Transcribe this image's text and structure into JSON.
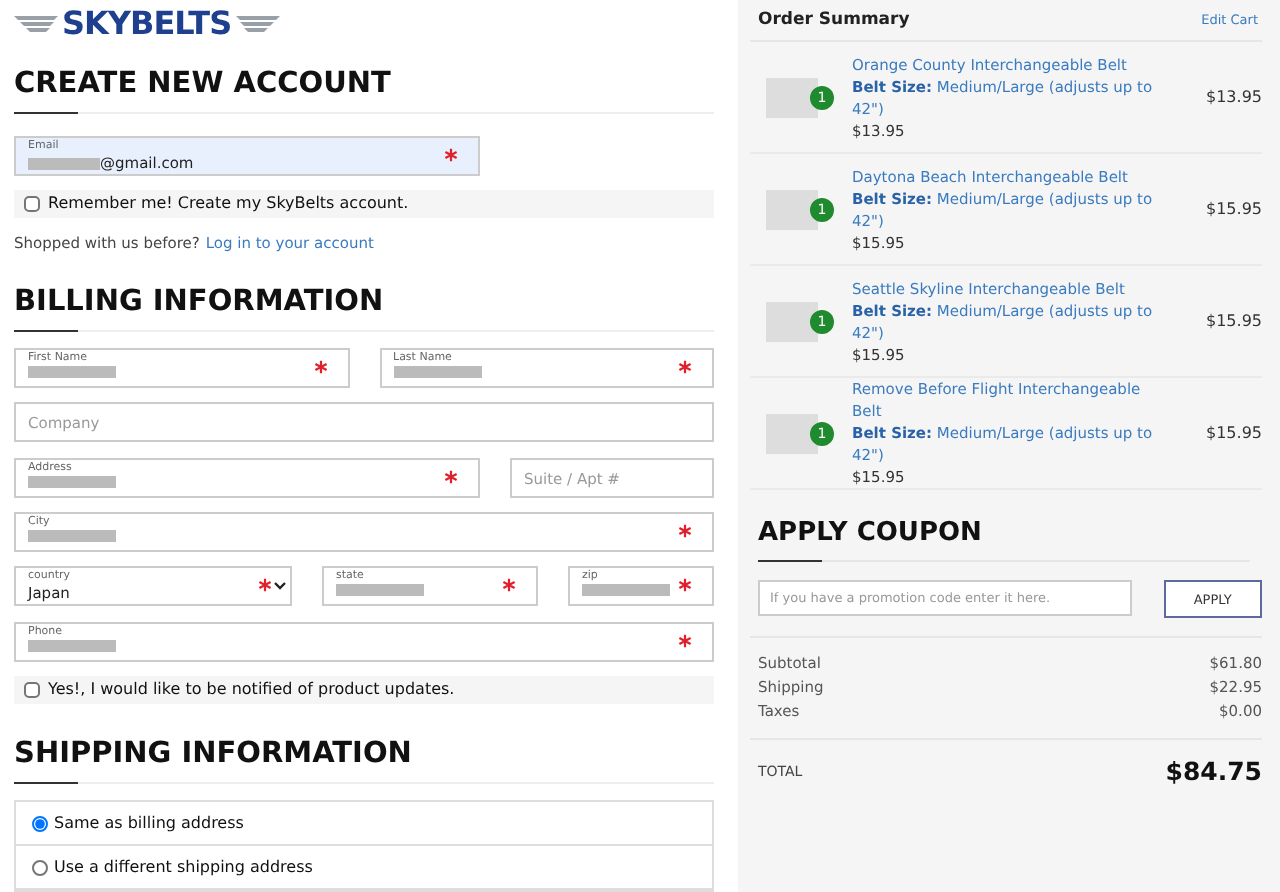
{
  "logo": {
    "text": "SKYBELTS"
  },
  "account": {
    "heading": "CREATE NEW ACCOUNT",
    "email": {
      "label": "Email",
      "value": "@gmail.com",
      "redacted": true,
      "required": true,
      "focused": true
    },
    "remember": {
      "label": "Remember me! Create my SkyBelts account.",
      "checked": false
    },
    "login_prompt": {
      "text": "Shopped with us before?",
      "link": "Log in to your account"
    }
  },
  "billing": {
    "heading": "BILLING INFORMATION",
    "fields": [
      {
        "kind": "text",
        "label": "First Name",
        "redacted": true,
        "required": true
      },
      {
        "kind": "text",
        "label": "Last Name",
        "redacted": true,
        "required": true
      },
      {
        "kind": "empty",
        "placeholder": "Company",
        "required": false
      },
      {
        "kind": "text",
        "label": "Address",
        "redacted": true,
        "required": true
      },
      {
        "kind": "empty",
        "placeholder": "Suite / Apt #",
        "required": false
      },
      {
        "kind": "text",
        "label": "City",
        "redacted": true,
        "required": true
      },
      {
        "kind": "select",
        "label": "country",
        "value": "Japan",
        "required": true
      },
      {
        "kind": "text",
        "label": "state",
        "redacted": true,
        "required": true
      },
      {
        "kind": "text",
        "label": "zip",
        "redacted": true,
        "required": true
      },
      {
        "kind": "text",
        "label": "Phone",
        "redacted": true,
        "required": true
      }
    ],
    "notify": {
      "label": "Yes!, I would like to be notified of product updates.",
      "checked": false
    }
  },
  "shipping": {
    "heading": "SHIPPING INFORMATION",
    "options": [
      {
        "label": "Same as billing address",
        "selected": true
      },
      {
        "label": "Use a different shipping address",
        "selected": false
      }
    ]
  },
  "summary": {
    "title": "Order Summary",
    "edit_link": "Edit Cart",
    "items": [
      {
        "name": "Orange County Interchangeable Belt",
        "option_label": "Belt Size:",
        "option_value": "Medium/Large (adjusts up to 42\")",
        "unit_price": "$13.95",
        "quantity": "1",
        "price": "$13.95"
      },
      {
        "name": "Daytona Beach Interchangeable Belt",
        "option_label": "Belt Size:",
        "option_value": "Medium/Large (adjusts up to 42\")",
        "unit_price": "$15.95",
        "quantity": "1",
        "price": "$15.95"
      },
      {
        "name": "Seattle Skyline Interchangeable Belt",
        "option_label": "Belt Size:",
        "option_value": "Medium/Large (adjusts up to 42\")",
        "unit_price": "$15.95",
        "quantity": "1",
        "price": "$15.95"
      },
      {
        "name": "Remove Before Flight Interchangeable Belt",
        "option_label": "Belt Size:",
        "option_value": "Medium/Large (adjusts up to 42\")",
        "unit_price": "$15.95",
        "quantity": "1",
        "price": "$15.95"
      }
    ],
    "coupon": {
      "heading": "APPLY COUPON",
      "placeholder": "If you have a promotion code enter it here.",
      "button": "APPLY"
    },
    "totals": [
      {
        "label": "Subtotal",
        "value": "$61.80"
      },
      {
        "label": "Shipping",
        "value": "$22.95"
      },
      {
        "label": "Taxes",
        "value": "$0.00"
      }
    ],
    "total": {
      "label": "TOTAL",
      "value": "$84.75"
    }
  }
}
